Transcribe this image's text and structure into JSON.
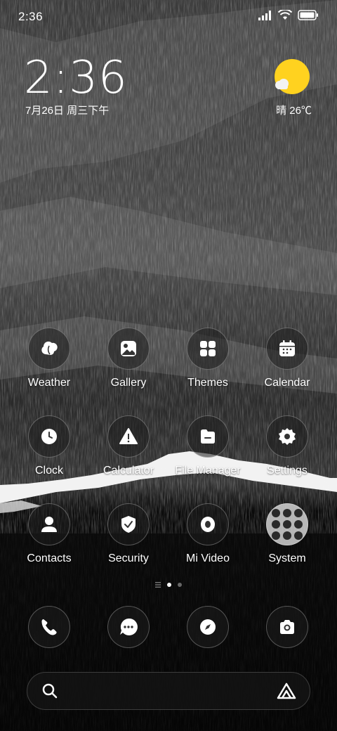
{
  "status_bar": {
    "time": "2:36"
  },
  "widget": {
    "clock": "2:36",
    "date": "7月26日 周三下午",
    "weather": "晴 26℃",
    "sun_color": "#FFD21F"
  },
  "apps": [
    {
      "label": "Weather",
      "icon": "weather-icon"
    },
    {
      "label": "Gallery",
      "icon": "gallery-icon"
    },
    {
      "label": "Themes",
      "icon": "themes-icon"
    },
    {
      "label": "Calendar",
      "icon": "calendar-icon"
    },
    {
      "label": "Clock",
      "icon": "clock-icon"
    },
    {
      "label": "Calculator",
      "icon": "calculator-icon"
    },
    {
      "label": "File Manager",
      "icon": "file-manager-icon"
    },
    {
      "label": "Settings",
      "icon": "settings-icon"
    },
    {
      "label": "Contacts",
      "icon": "contacts-icon"
    },
    {
      "label": "Security",
      "icon": "security-icon"
    },
    {
      "label": "Mi Video",
      "icon": "mi-video-icon"
    },
    {
      "label": "System",
      "icon": "folder-icon"
    }
  ],
  "page_indicator": {
    "active_index": 1,
    "pages": 2
  },
  "dock": [
    {
      "icon": "phone-icon"
    },
    {
      "icon": "messages-icon"
    },
    {
      "icon": "browser-icon"
    },
    {
      "icon": "camera-icon"
    }
  ],
  "search": {
    "placeholder": "",
    "icon": "search-icon",
    "assistant_icon": "app-vault-icon"
  }
}
